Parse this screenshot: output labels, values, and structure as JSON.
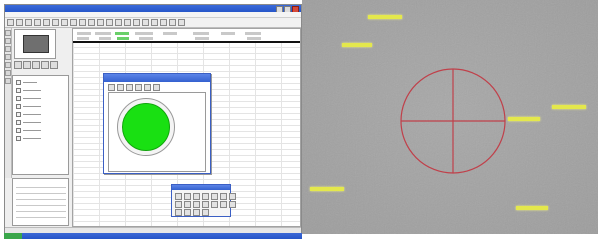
{
  "left_app": {
    "title": "",
    "menus": [
      "",
      "",
      "",
      "",
      "",
      "",
      "",
      ""
    ],
    "nav_items": [
      "",
      "",
      "",
      "",
      "",
      "",
      "",
      "",
      ""
    ]
  },
  "overlay": {
    "target_circle_color": "#c0404a",
    "marker_color": "#e4e84c",
    "fill_color": "#19e012"
  },
  "icons": [
    "close-icon",
    "maximize-icon",
    "minimize-icon"
  ]
}
